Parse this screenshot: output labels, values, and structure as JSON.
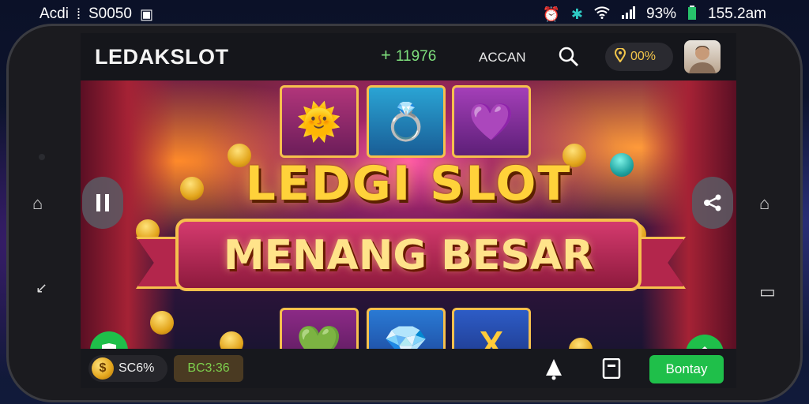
{
  "status_bar": {
    "left_text": "Acdi",
    "left_time": "S0050",
    "battery": "93%",
    "time": "155.2am"
  },
  "header": {
    "logo": "LEDAKSLOT",
    "plus_value": "11976",
    "link_text": "ACCAN",
    "wallet_value": "00%"
  },
  "banner": {
    "title_top": "LEDGI SLOT",
    "title_bottom": "MENANG BESAR"
  },
  "footer": {
    "coins_value": "SC6%",
    "bonus_label": "BC3:36",
    "action_button": "Bontay"
  },
  "colors": {
    "accent_green": "#1fbf4a",
    "gold": "#f6c04d",
    "topbar_bg": "#15161b"
  }
}
